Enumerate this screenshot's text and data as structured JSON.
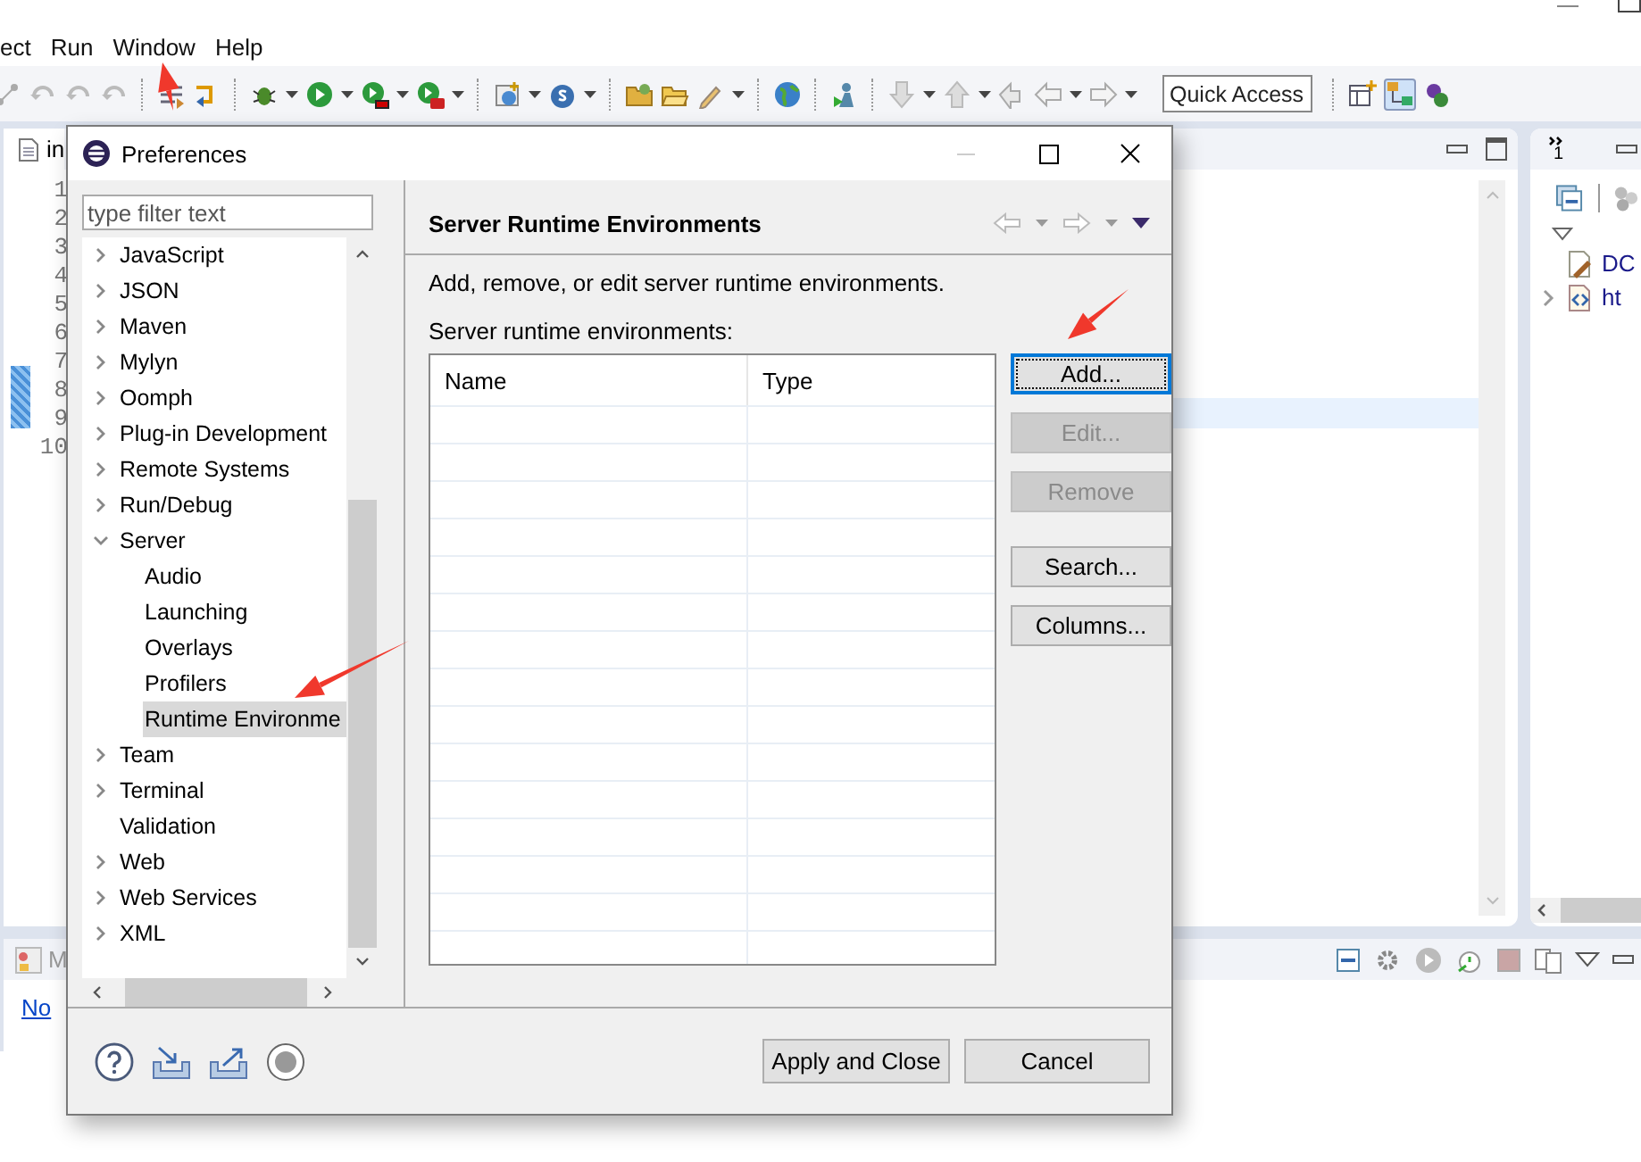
{
  "menu_bar": [
    {
      "label": "ect"
    },
    {
      "label": "Run"
    },
    {
      "label": "Window"
    },
    {
      "label": "Help"
    }
  ],
  "quick_access": {
    "placeholder": "Quick Access"
  },
  "editor": {
    "tab": "in",
    "line_numbers": [
      "1",
      "2",
      "3",
      "4",
      "5",
      "6",
      "7",
      "8",
      "9",
      "10"
    ]
  },
  "outline": {
    "tab_badge": "1",
    "items": [
      {
        "label": "DC"
      },
      {
        "label": "ht",
        "expanded": false
      }
    ]
  },
  "bottom_panel": {
    "tab": "M",
    "link": "No"
  },
  "dialog": {
    "title": "Preferences",
    "filter": {
      "placeholder": "type filter text"
    },
    "tree": [
      {
        "label": "JavaScript",
        "expanded": false,
        "selected": false
      },
      {
        "label": "JSON",
        "expanded": false,
        "selected": false
      },
      {
        "label": "Maven",
        "expanded": false,
        "selected": false
      },
      {
        "label": "Mylyn",
        "expanded": false,
        "selected": false
      },
      {
        "label": "Oomph",
        "expanded": false,
        "selected": false
      },
      {
        "label": "Plug-in Development",
        "expanded": false,
        "selected": false
      },
      {
        "label": "Remote Systems",
        "expanded": false,
        "selected": false
      },
      {
        "label": "Run/Debug",
        "expanded": false,
        "selected": false
      },
      {
        "label": "Server",
        "expanded": true,
        "selected": false,
        "children": [
          {
            "label": "Audio",
            "selected": false
          },
          {
            "label": "Launching",
            "selected": false
          },
          {
            "label": "Overlays",
            "selected": false
          },
          {
            "label": "Profilers",
            "selected": false
          },
          {
            "label": "Runtime Environme",
            "selected": true
          }
        ]
      },
      {
        "label": "Team",
        "expanded": false,
        "selected": false
      },
      {
        "label": "Terminal",
        "expanded": false,
        "selected": false
      },
      {
        "label": "Validation",
        "selected": false
      },
      {
        "label": "Web",
        "expanded": false,
        "selected": false
      },
      {
        "label": "Web Services",
        "expanded": false,
        "selected": false
      },
      {
        "label": "XML",
        "expanded": false,
        "selected": false
      }
    ],
    "page": {
      "title": "Server Runtime Environments",
      "description": "Add, remove, or edit server runtime environments.",
      "list_label": "Server runtime environments:",
      "columns": [
        "Name",
        "Type"
      ],
      "buttons": [
        {
          "label": "Add...",
          "disabled": false,
          "focused": true
        },
        {
          "label": "Edit...",
          "disabled": true,
          "focused": false
        },
        {
          "label": "Remove",
          "disabled": true,
          "focused": false
        },
        {
          "label": "Search...",
          "disabled": false,
          "focused": false
        },
        {
          "label": "Columns...",
          "disabled": false,
          "focused": false
        }
      ]
    },
    "footer_buttons": [
      "Apply and Close",
      "Cancel"
    ]
  }
}
